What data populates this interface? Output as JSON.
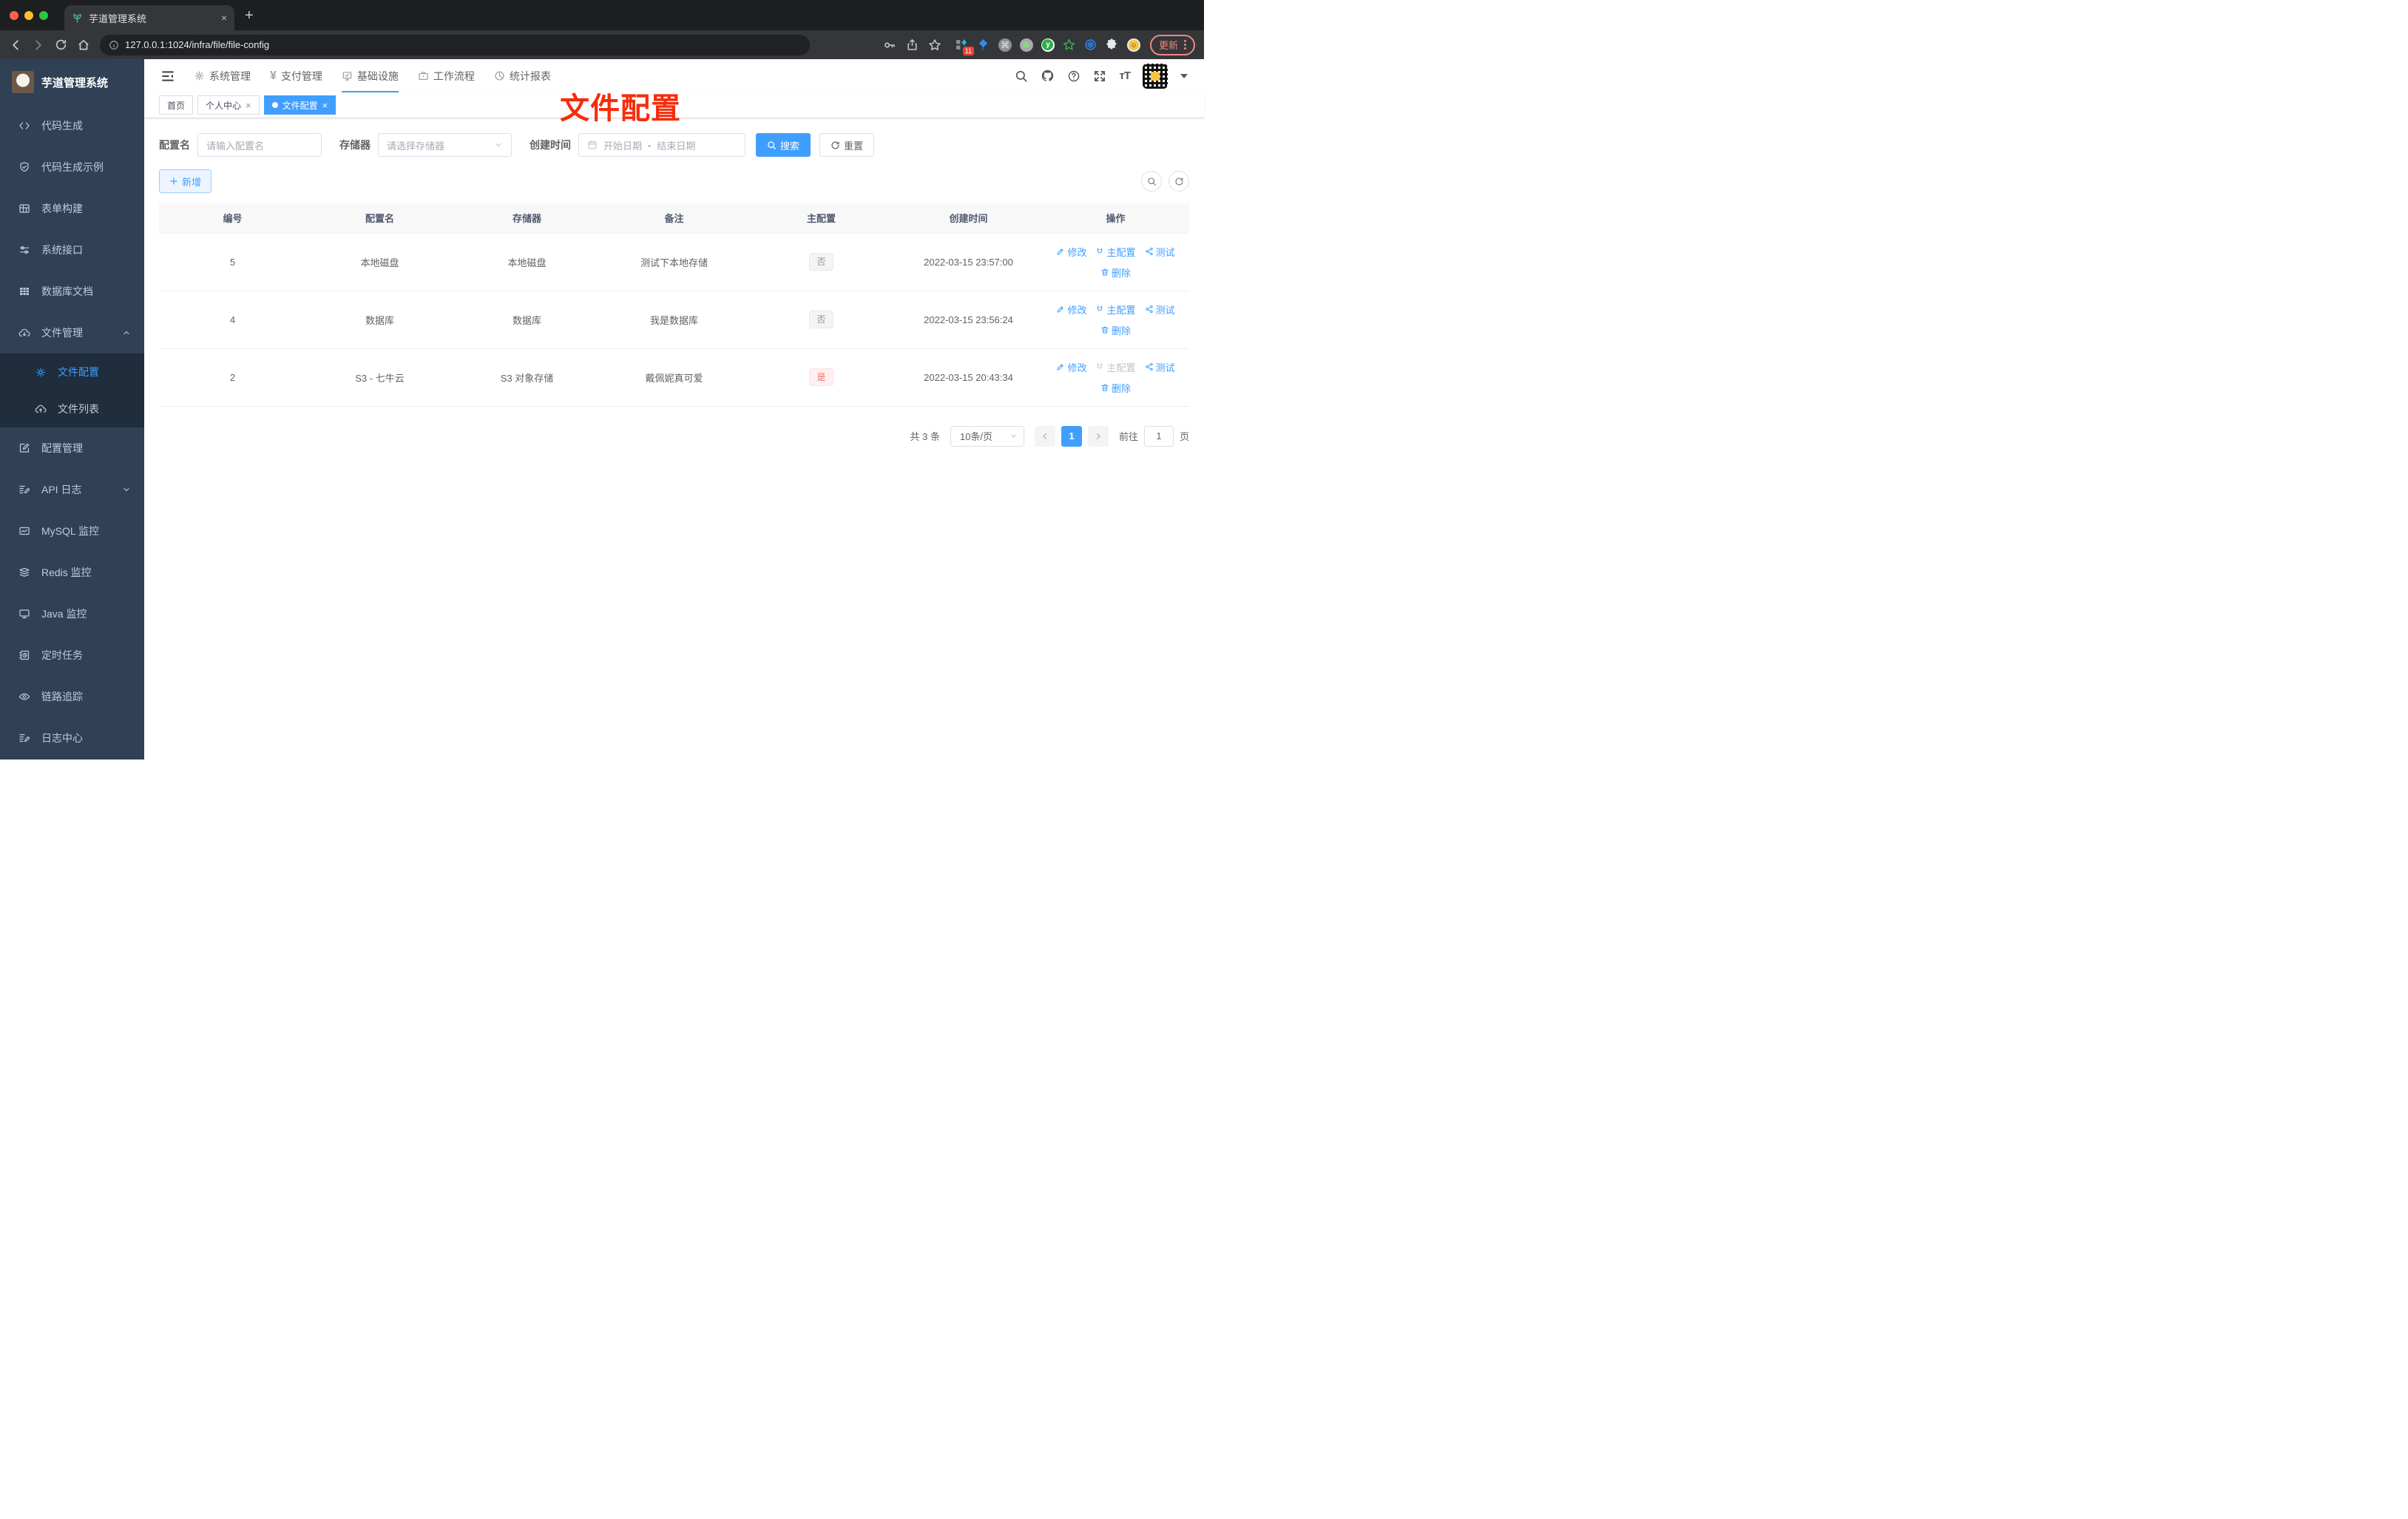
{
  "browser": {
    "tab_title": "芋道管理系统",
    "url": "127.0.0.1:1024/infra/file/file-config",
    "extension_badge": "11",
    "update_label": "更新",
    "new_tab_label": "+",
    "close_label": "×"
  },
  "sidebar": {
    "logo_title": "芋道管理系统",
    "items": [
      {
        "label": "代码生成"
      },
      {
        "label": "代码生成示例"
      },
      {
        "label": "表单构建"
      },
      {
        "label": "系统接口"
      },
      {
        "label": "数据库文档"
      },
      {
        "label": "文件管理"
      },
      {
        "label": "文件配置"
      },
      {
        "label": "文件列表"
      },
      {
        "label": "配置管理"
      },
      {
        "label": "API 日志"
      },
      {
        "label": "MySQL 监控"
      },
      {
        "label": "Redis 监控"
      },
      {
        "label": "Java 监控"
      },
      {
        "label": "定时任务"
      },
      {
        "label": "链路追踪"
      },
      {
        "label": "日志中心"
      }
    ]
  },
  "topnav": {
    "items": [
      {
        "label": "系统管理"
      },
      {
        "label": "支付管理"
      },
      {
        "label": "基础设施"
      },
      {
        "label": "工作流程"
      },
      {
        "label": "统计报表"
      }
    ]
  },
  "tabs": [
    {
      "label": "首页"
    },
    {
      "label": "个人中心"
    },
    {
      "label": "文件配置"
    }
  ],
  "annotation": {
    "text": "文件配置"
  },
  "filter": {
    "name_label": "配置名",
    "name_placeholder": "请输入配置名",
    "storage_label": "存储器",
    "storage_placeholder": "请选择存储器",
    "date_label": "创建时间",
    "date_start_placeholder": "开始日期",
    "date_separator": "-",
    "date_end_placeholder": "结束日期",
    "search_label": "搜索",
    "reset_label": "重置",
    "add_label": "新增"
  },
  "table": {
    "columns": [
      "编号",
      "配置名",
      "存储器",
      "备注",
      "主配置",
      "创建时间",
      "操作"
    ],
    "actions": {
      "edit": "修改",
      "master": "主配置",
      "test": "测试",
      "delete": "删除"
    },
    "rows": [
      {
        "id": "5",
        "name": "本地磁盘",
        "storage": "本地磁盘",
        "remark": "测试下本地存储",
        "master": "否",
        "created": "2022-03-15 23:57:00"
      },
      {
        "id": "4",
        "name": "数据库",
        "storage": "数据库",
        "remark": "我是数据库",
        "master": "否",
        "created": "2022-03-15 23:56:24"
      },
      {
        "id": "2",
        "name": "S3 - 七牛云",
        "storage": "S3 对象存储",
        "remark": "戴佩妮真可爱",
        "master": "是",
        "created": "2022-03-15 20:43:34"
      }
    ]
  },
  "pagination": {
    "total": "共 3 条",
    "page_size": "10条/页",
    "current_page": "1",
    "goto_label": "前往",
    "goto_value": "1",
    "unit_label": "页"
  },
  "colors": {
    "accent": "#409eff",
    "annotation_red": "#f62c0c",
    "danger": "#f56c6c",
    "sidebar_bg": "#304156"
  }
}
